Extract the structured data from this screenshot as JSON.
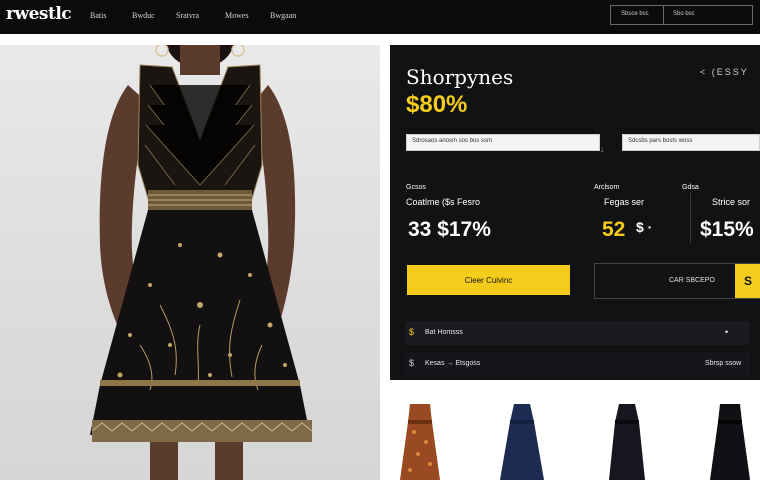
{
  "header": {
    "logo": "rwestlc",
    "nav": [
      "Batis",
      "Bwduc",
      "Sratvra",
      "Mowes",
      "Bwgaan"
    ],
    "right_box": {
      "left": "Sbsce bsc",
      "right": "Sbo bsc"
    }
  },
  "product": {
    "title": "Shorpynes",
    "price": "$80%",
    "nav_glyph": "< (ESSY",
    "search_placeholder": "Sdrosaos anosm sos bos ssm",
    "filter_placeholder": "Sdcsbs pars bosts woss",
    "stats": [
      {
        "label": "Gcsos",
        "sub": "Coatlme ($s Fesro",
        "value": "33 $17%"
      },
      {
        "label": "Arclsom",
        "sub": "Fegas ser",
        "value": "52"
      },
      {
        "label": "Gdsa",
        "sub": "Strice sor",
        "value": "$15%"
      }
    ],
    "stat2_suffix": "$ ·",
    "cta_primary": "Cieer Cuivinc",
    "cta_secondary": "CAR SBCEPO",
    "cta_secondary_tag": "S",
    "rows": [
      {
        "icon": "$",
        "label": "Bat Homsss",
        "end": "•"
      },
      {
        "icon": "$",
        "label": "Kesas → Etsgoss",
        "end": "Sbrsp ssow"
      }
    ]
  },
  "colors": {
    "accent": "#f5cc1b",
    "panel": "#111214",
    "header": "#0b0b0b"
  },
  "thumbnails": [
    {
      "name": "print-dress"
    },
    {
      "name": "navy-dress"
    },
    {
      "name": "black-dress"
    },
    {
      "name": "black-midi-dress"
    }
  ]
}
